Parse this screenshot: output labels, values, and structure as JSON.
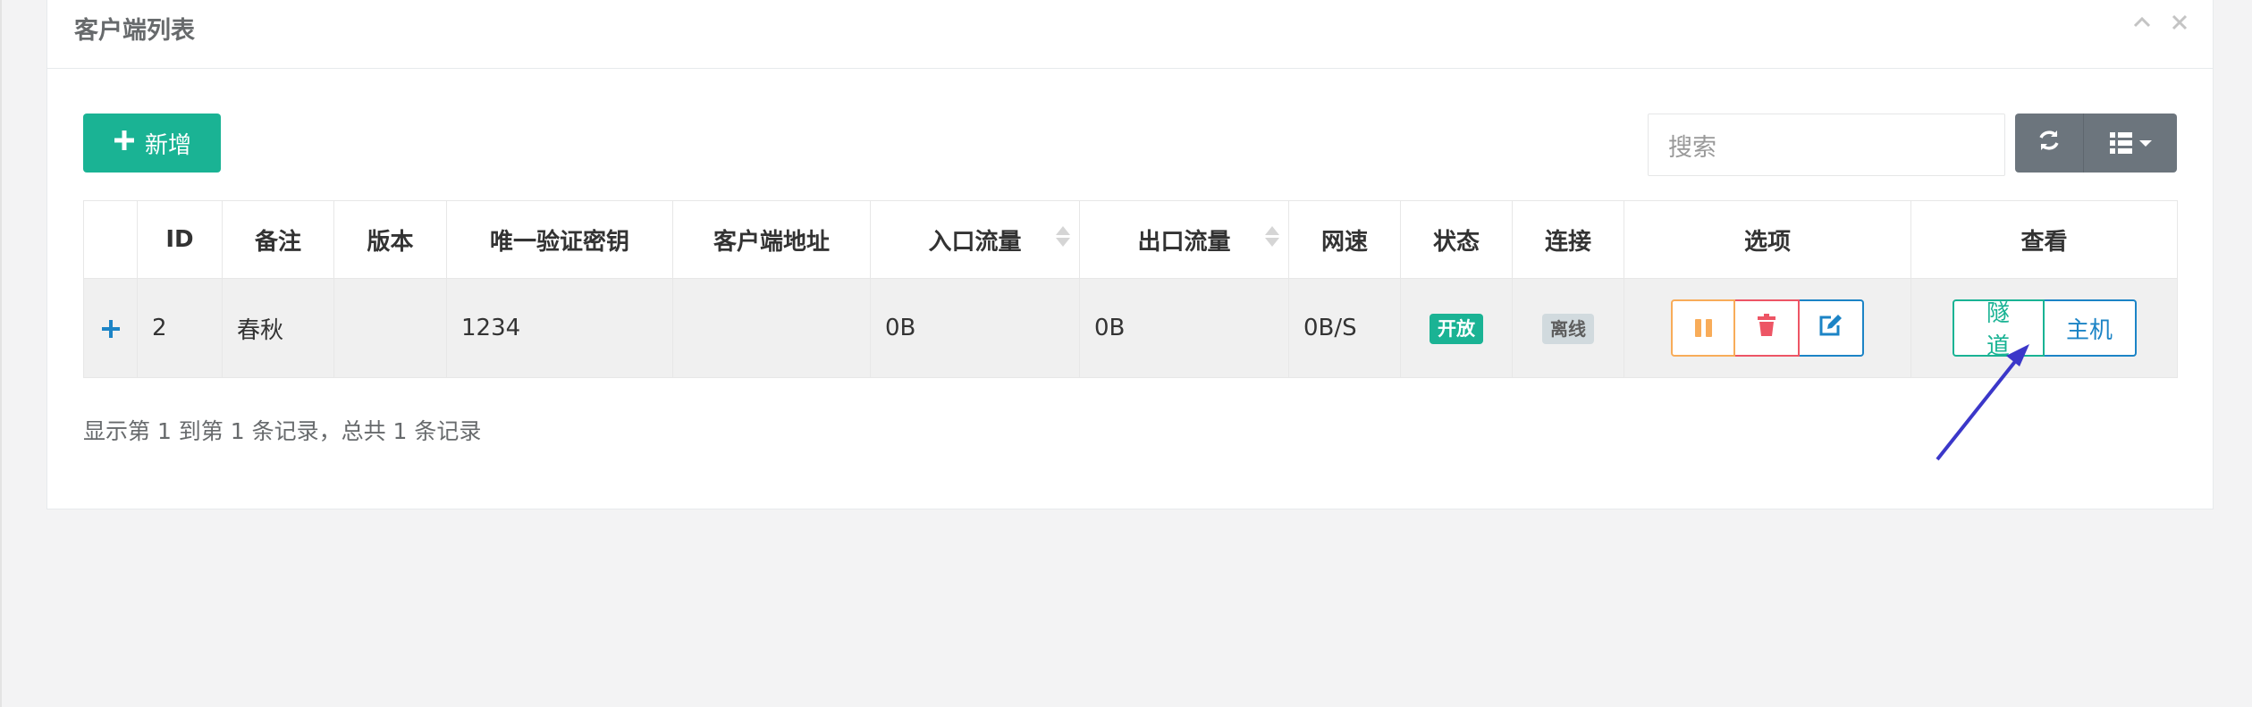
{
  "panel": {
    "title": "客户端列表",
    "collapse_icon": "chevron-up-icon",
    "close_icon": "close-icon"
  },
  "toolbar": {
    "add_label": "新增",
    "search_placeholder": "搜索",
    "refresh_icon": "refresh-icon",
    "columns_icon": "list-columns-icon"
  },
  "table": {
    "headers": [
      "",
      "ID",
      "备注",
      "版本",
      "唯一验证密钥",
      "客户端地址",
      "入口流量",
      "出口流量",
      "网速",
      "状态",
      "连接",
      "选项",
      "查看"
    ],
    "rows": [
      {
        "id": "2",
        "remark": "春秋",
        "version": "",
        "verify_key": "1234",
        "client_addr": "",
        "in_flow": "0B",
        "out_flow": "0B",
        "speed": "0B/S",
        "status": "开放",
        "connection": "离线",
        "view_tunnel": "隧道",
        "view_host": "主机"
      }
    ]
  },
  "pagination": {
    "info": "显示第 1 到第 1 条记录，总共 1 条记录"
  },
  "colors": {
    "primary": "#1ab394",
    "info": "#1c84c6",
    "warning": "#f8ac59",
    "danger": "#ed5565",
    "secondary": "#6c757d",
    "annotation_arrow": "#3b37c9"
  }
}
